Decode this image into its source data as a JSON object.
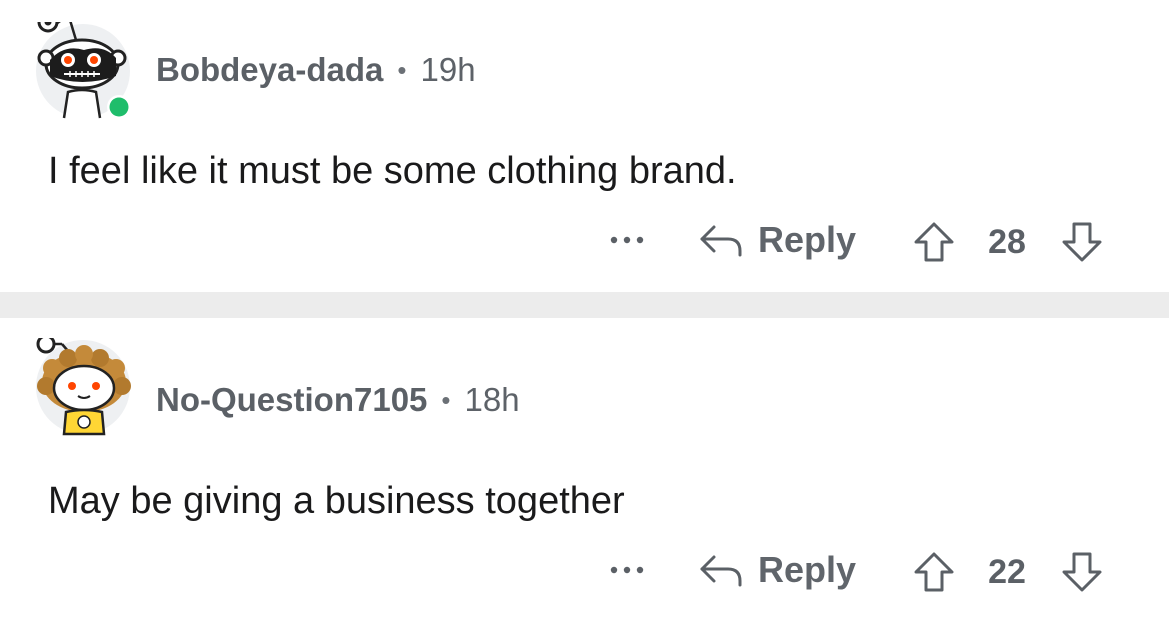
{
  "comments": [
    {
      "username": "Bobdeya-dada",
      "separator": "•",
      "time": "19h",
      "body": "I feel like it must be some clothing brand.",
      "more_icon": "ellipsis-icon",
      "reply_icon": "reply-arrow-icon",
      "reply_label": "Reply",
      "upvote_icon": "upvote-arrow-icon",
      "score": "28",
      "downvote_icon": "downvote-arrow-icon",
      "online": true
    },
    {
      "username": "No-Question7105",
      "separator": "•",
      "time": "18h",
      "body": "May be giving a business together",
      "more_icon": "ellipsis-icon",
      "reply_icon": "reply-arrow-icon",
      "reply_label": "Reply",
      "upvote_icon": "upvote-arrow-icon",
      "score": "22",
      "downvote_icon": "downvote-arrow-icon",
      "online": false
    }
  ],
  "colors": {
    "meta_text": "#5d6268",
    "body_text": "#1a1a1b",
    "separator_bg": "#ececec",
    "online_dot": "#1fbd6b",
    "avatar_bg": "#eef0f2"
  }
}
